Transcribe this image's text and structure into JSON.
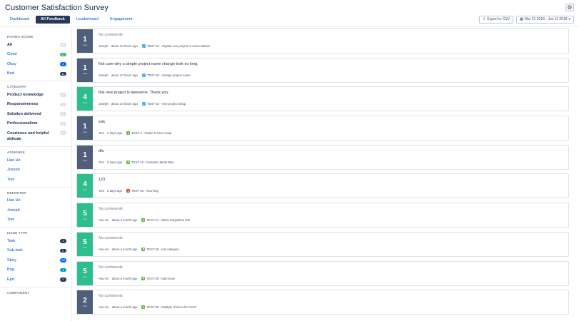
{
  "header": {
    "title": "Customer Satisfaction Survey",
    "settings_icon": "gear-icon"
  },
  "tabs": [
    {
      "label": "Dashboard",
      "active": false
    },
    {
      "label": "All Feedback",
      "active": true
    },
    {
      "label": "Leaderboard",
      "active": false
    },
    {
      "label": "Engagement",
      "active": false
    }
  ],
  "toolbar": {
    "export_label": "Export to CSV",
    "export_icon": "export-icon",
    "date_range": "Mar 21 2018 - Jun 11 2018",
    "calendar_icon": "calendar-icon"
  },
  "sidebar": {
    "rating": {
      "heading": "RATING SCORE",
      "items": [
        {
          "label": "All",
          "count": "40"
        },
        {
          "label": "Good",
          "count": "17"
        },
        {
          "label": "Okay",
          "count": "6"
        },
        {
          "label": "Bad",
          "count": "11"
        }
      ]
    },
    "category": {
      "heading": "CATEGORY",
      "items": [
        {
          "label": "Product knowledge",
          "count": "0"
        },
        {
          "label": "Responsiveness",
          "count": "0"
        },
        {
          "label": "Solution delivered",
          "count": "0"
        },
        {
          "label": "Professionalism",
          "count": "0"
        },
        {
          "label": "Courteous and helpful attitude",
          "count": "0"
        }
      ]
    },
    "assignee": {
      "heading": "ASSIGNEE",
      "items": [
        {
          "label": "Hao Ho"
        },
        {
          "label": "Joseph"
        },
        {
          "label": "Tom"
        }
      ]
    },
    "reporter": {
      "heading": "REPORTER",
      "items": [
        {
          "label": "Hao Ho"
        },
        {
          "label": "Joseph"
        },
        {
          "label": "Tom"
        }
      ]
    },
    "issue_type": {
      "heading": "ISSUE TYPE",
      "items": [
        {
          "label": "Task",
          "count": "3"
        },
        {
          "label": "Sub-task",
          "count": "0"
        },
        {
          "label": "Story",
          "count": "34"
        },
        {
          "label": "Bug",
          "count": "4"
        },
        {
          "label": "Epic",
          "count": "0"
        }
      ]
    },
    "component": {
      "heading": "COMPONENT"
    }
  },
  "feedback": [
    {
      "score": "1",
      "score_unit": "score",
      "comment": "No comments",
      "user": "Joseph",
      "time": "about 10 hours ago",
      "issue": "TEST-34 - migrate ceo project to new instance"
    },
    {
      "score": "1",
      "score_unit": "score",
      "comment": "Not sure why a simple project name change took so long.",
      "user": "Joseph",
      "time": "about 10 hours ago",
      "issue": "TEST-35 - change project name"
    },
    {
      "score": "4",
      "score_unit": "score",
      "comment": "this new project is awesome. Thank you.",
      "user": "Joseph",
      "time": "about 10 hours ago",
      "issue": "TEST-33 - new project setup"
    },
    {
      "score": "1",
      "score_unit": "score",
      "comment": "sda",
      "user": "Tom",
      "time": "5 days ago",
      "issue": "TEST-4 - Rustic Frozen Soap"
    },
    {
      "score": "1",
      "score_unit": "score",
      "comment": "dfs",
      "user": "Tom",
      "time": "5 days ago",
      "issue": "TEST-10 - Fantastic Metal Bike"
    },
    {
      "score": "4",
      "score_unit": "score",
      "comment": "123",
      "user": "Tom",
      "time": "5 days ago",
      "issue": "TEST-02 - New bug"
    },
    {
      "score": "5",
      "score_unit": "score",
      "comment": "No comments",
      "user": "Hao Ho",
      "time": "about a month ago",
      "issue": "TEST-21 - Black Integration test"
    },
    {
      "score": "5",
      "score_unit": "score",
      "comment": "No comments",
      "user": "Hao Ho",
      "time": "about a month ago",
      "issue": "TEST-25 - test category"
    },
    {
      "score": "5",
      "score_unit": "score",
      "comment": "No comments",
      "user": "Hao Ho",
      "time": "about a month ago",
      "issue": "TEST-30 - bad move"
    },
    {
      "score": "2",
      "score_unit": "score",
      "comment": "No comments",
      "user": "Hao Ho",
      "time": "about a month ago",
      "issue": "TEST-28 - Multiple choices for CSAT"
    }
  ]
}
